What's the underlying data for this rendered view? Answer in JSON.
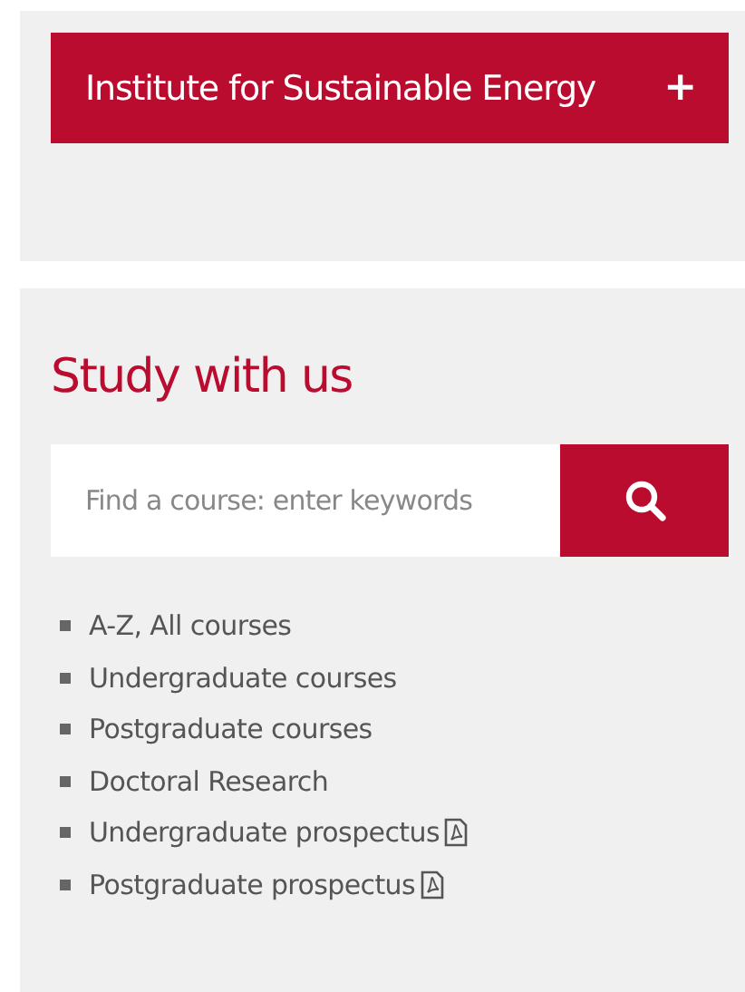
{
  "accordion": {
    "label": "Institute for Sustainable Energy",
    "toggle": "+",
    "expanded": false
  },
  "study": {
    "heading": "Study with us",
    "search": {
      "placeholder": "Find a course: enter keywords"
    },
    "links": [
      {
        "label": "A-Z, All courses",
        "pdf": false
      },
      {
        "label": "Undergraduate courses",
        "pdf": false
      },
      {
        "label": "Postgraduate courses",
        "pdf": false
      },
      {
        "label": "Doctoral Research",
        "pdf": false
      },
      {
        "label": "Undergraduate prospectus",
        "pdf": true
      },
      {
        "label": "Postgraduate prospectus",
        "pdf": true
      }
    ]
  }
}
